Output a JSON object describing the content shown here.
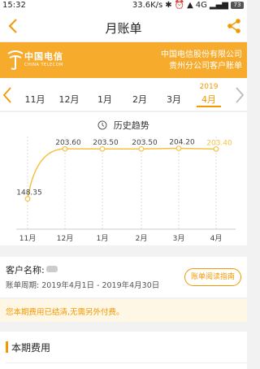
{
  "status_bar": {
    "time": "15:32",
    "speed": "33.6K/s",
    "network": "4G",
    "battery": "73"
  },
  "nav": {
    "title": "月账单",
    "back_icon": "chevron-left-icon",
    "share_icon": "share-icon"
  },
  "banner": {
    "logo_text": "中国电信",
    "logo_sub": "CHINA TELECOM",
    "org_line1": "中国电信股份有限公司",
    "org_line2": "贵州分公司客户账单",
    "background": "#f6ab2c"
  },
  "month_selector": {
    "year_label": "2019",
    "months": [
      "11月",
      "12月",
      "1月",
      "2月",
      "3月",
      "4月"
    ],
    "selected": "4月",
    "accent": "#f39800"
  },
  "trend": {
    "heading": "历史趋势"
  },
  "chart_data": {
    "type": "line",
    "categories": [
      "11月",
      "12月",
      "1月",
      "2月",
      "3月",
      "4月"
    ],
    "values": [
      148.35,
      203.6,
      203.5,
      203.5,
      204.2,
      203.4
    ],
    "labels": [
      "148.35",
      "203.60",
      "203.50",
      "203.50",
      "204.20",
      "203.40"
    ],
    "highlight_index": 5,
    "line_color": "#f6c244",
    "highlight_color": "#f6c244",
    "grid": "vertical-dashed"
  },
  "customer": {
    "name_label": "客户名称:",
    "period_label": "账单周期: 2019年4月1日 - 2019年4月30日",
    "guide_button": "账单阅读指南"
  },
  "notice": {
    "text": "您本期费用已结清,无需另外付费。"
  },
  "section": {
    "title": "本期费用"
  }
}
